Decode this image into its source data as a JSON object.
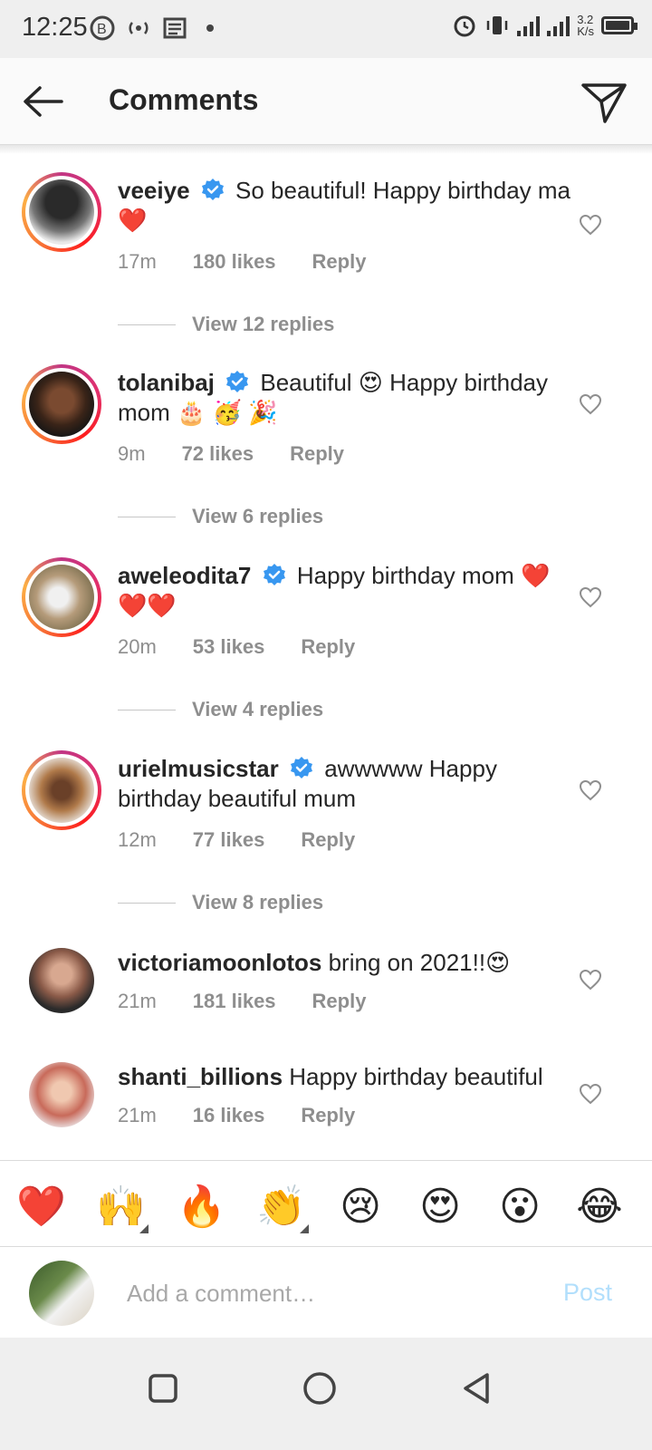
{
  "status_bar": {
    "time": "12:25",
    "speed": "3.2",
    "speed_unit": "K/s"
  },
  "header": {
    "title": "Comments"
  },
  "comments": [
    {
      "username": "veeiye",
      "verified": true,
      "text": "So beautiful! Happy birthday ma ❤️",
      "time": "17m",
      "likes": "180 likes",
      "reply": "Reply",
      "view_replies": "View 12 replies"
    },
    {
      "username": "tolanibaj",
      "verified": true,
      "text": "Beautiful 😍 Happy birthday mom 🎂 🥳 🎉",
      "time": "9m",
      "likes": "72 likes",
      "reply": "Reply",
      "view_replies": "View 6 replies"
    },
    {
      "username": "aweleodita7",
      "verified": true,
      "text": "Happy birthday mom ❤️❤️❤️",
      "time": "20m",
      "likes": "53 likes",
      "reply": "Reply",
      "view_replies": "View 4 replies"
    },
    {
      "username": "urielmusicstar",
      "verified": true,
      "text": "awwwww Happy birthday beautiful mum",
      "time": "12m",
      "likes": "77 likes",
      "reply": "Reply",
      "view_replies": "View 8 replies"
    },
    {
      "username": "victoriamoonlotos",
      "verified": false,
      "text": "bring on 2021!!😍",
      "time": "21m",
      "likes": "181 likes",
      "reply": "Reply"
    },
    {
      "username": "shanti_billions",
      "verified": false,
      "text": "Happy birthday beautiful",
      "time": "21m",
      "likes": "16 likes",
      "reply": "Reply"
    }
  ],
  "emoji_bar": [
    "❤️",
    "🙌",
    "🔥",
    "👏",
    "😢",
    "😍",
    "😮",
    "😂"
  ],
  "composer": {
    "placeholder": "Add a comment…",
    "post_label": "Post"
  },
  "colors": {
    "link_blue": "#b2dffc",
    "verified_blue": "#3897f0",
    "muted": "#8e8e8e"
  }
}
